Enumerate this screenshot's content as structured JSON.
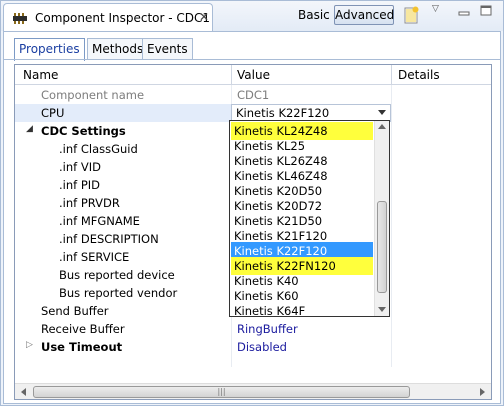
{
  "view": {
    "title": "Component Inspector - CDC1",
    "basic_label": "Basic",
    "advanced_label": "Advanced"
  },
  "tabs": [
    {
      "label": "Properties",
      "active": true
    },
    {
      "label": "Methods",
      "active": false
    },
    {
      "label": "Events",
      "active": false
    }
  ],
  "columns": {
    "name": "Name",
    "value": "Value",
    "details": "Details"
  },
  "rows": [
    {
      "name": "Component name",
      "value": "CDC1"
    },
    {
      "name": "CPU",
      "value": "Kinetis K22F120"
    },
    {
      "name": "CDC Settings",
      "value": ""
    },
    {
      "name": ".inf ClassGuid",
      "value": ""
    },
    {
      "name": ".inf VID",
      "value": ""
    },
    {
      "name": ".inf PID",
      "value": ""
    },
    {
      "name": ".inf PRVDR",
      "value": ""
    },
    {
      "name": ".inf MFGNAME",
      "value": ""
    },
    {
      "name": ".inf DESCRIPTION",
      "value": ""
    },
    {
      "name": ".inf SERVICE",
      "value": ""
    },
    {
      "name": "Bus reported device",
      "value": ""
    },
    {
      "name": "Bus reported vendor",
      "value": ""
    },
    {
      "name": "Send Buffer",
      "value": ""
    },
    {
      "name": "Receive Buffer",
      "value": "RingBuffer"
    },
    {
      "name": "Use Timeout",
      "value": "Disabled"
    }
  ],
  "dropdown": {
    "items": [
      "Kinetis KL24Z48",
      "Kinetis KL25",
      "Kinetis KL26Z48",
      "Kinetis KL46Z48",
      "Kinetis K20D50",
      "Kinetis K20D72",
      "Kinetis K21D50",
      "Kinetis K21F120",
      "Kinetis K22F120",
      "Kinetis K22FN120",
      "Kinetis K40",
      "Kinetis K60",
      "Kinetis K64F"
    ],
    "selected": "Kinetis K22F120",
    "highlighted": [
      "Kinetis KL24Z48",
      "Kinetis K22FN120"
    ]
  },
  "colors": {
    "accent": "#1a3ea1",
    "selection": "#3399ff",
    "highlight": "#ffff3c",
    "value_link": "#1a1a9e"
  }
}
